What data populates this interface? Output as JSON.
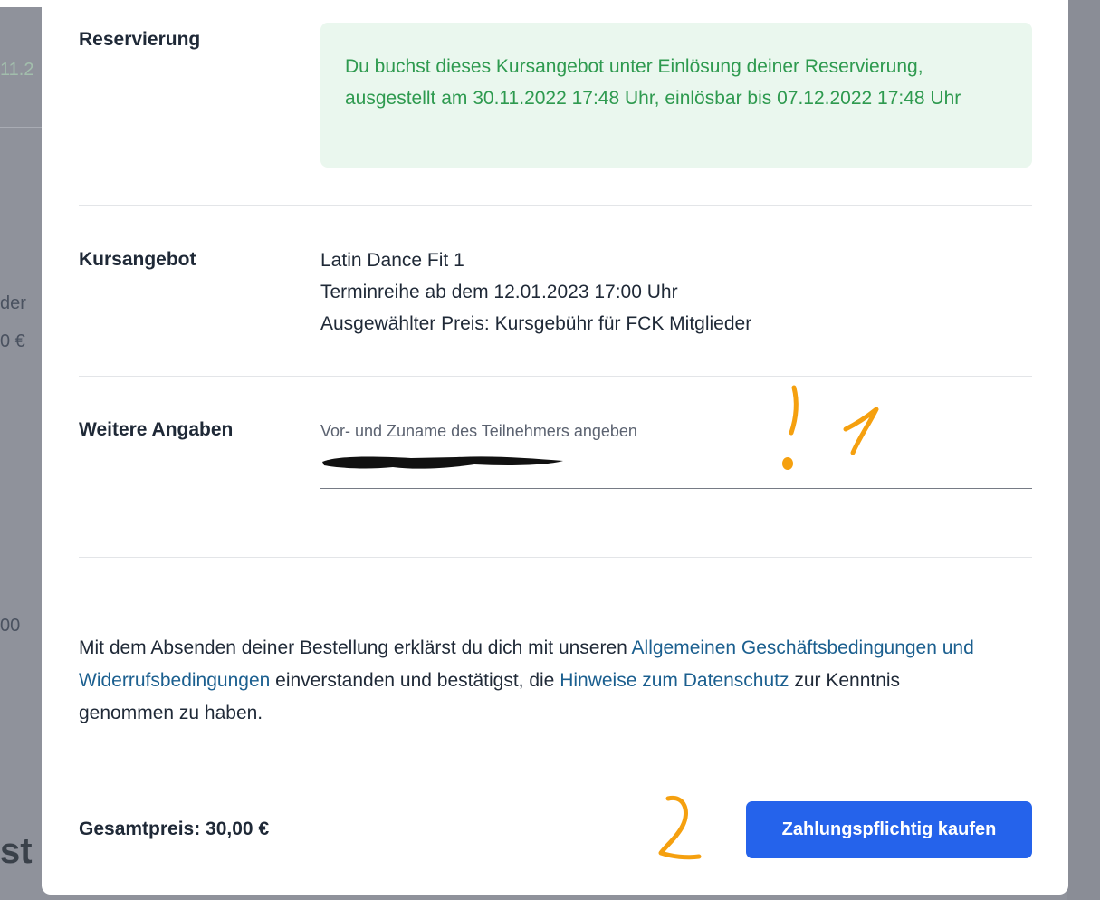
{
  "background": {
    "fragments": [
      "11.2",
      "der",
      "0 €",
      "00",
      "st"
    ]
  },
  "reservation": {
    "label": "Reservierung",
    "notice": "Du buchst dieses Kursangebot unter Einlösung deiner Reservierung, ausgestellt am 30.11.2022 17:48 Uhr, einlösbar bis 07.12.2022 17:48 Uhr"
  },
  "course": {
    "label": "Kursangebot",
    "name": "Latin Dance Fit 1",
    "schedule": "Terminreihe ab dem 12.01.2023 17:00 Uhr",
    "price": "Ausgewählter Preis: Kursgebühr für FCK Mitglieder"
  },
  "details": {
    "label": "Weitere Angaben",
    "field_label": "Vor- und Zuname des Teilnehmers angeben"
  },
  "terms": {
    "intro": "Mit dem Absenden deiner Bestellung erklärst du dich mit unseren ",
    "agb_link": "Allgemeinen Geschäftsbedingungen und Widerrufsbedingungen",
    "middle": " einverstanden und bestätigst, die ",
    "privacy_link": "Hinweise zum Datenschutz",
    "outro": " zur Kenntnis genommen zu haben."
  },
  "footer": {
    "total": "Gesamtpreis: 30,00 €",
    "buy_button": "Zahlungspflichtig kaufen"
  },
  "annotations": {
    "mark_1": "!",
    "mark_2": "1",
    "mark_3": "2",
    "color": "#f5a00f"
  },
  "colors": {
    "accent": "#2563eb",
    "notice_bg": "#eaf7ee",
    "notice_text": "#2e9a4f",
    "link": "#1b5f8f",
    "backdrop": "#8f929b"
  }
}
